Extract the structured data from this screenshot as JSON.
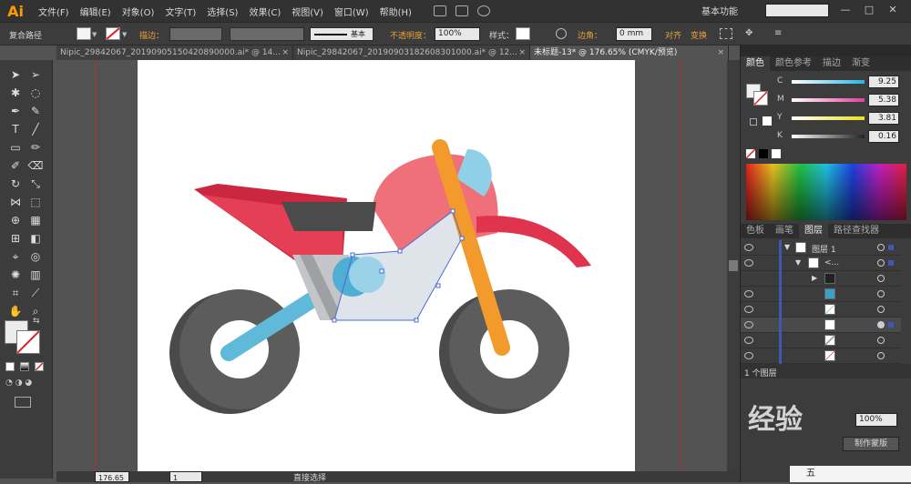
{
  "app": {
    "logo": "Ai"
  },
  "menu": [
    "文件(F)",
    "编辑(E)",
    "对象(O)",
    "文字(T)",
    "选择(S)",
    "效果(C)",
    "视图(V)",
    "窗口(W)",
    "帮助(H)"
  ],
  "workspace": "基本功能",
  "control": {
    "label": "复合路径",
    "stroke_label": "描边：",
    "stroke_style": "基本",
    "opacity_label": "不透明度：",
    "opacity_value": "100%",
    "style_label": "样式：",
    "corner_label": "边角：",
    "corner_value": "0 mm",
    "align_label": "对齐",
    "transform_label": "变换"
  },
  "tabs": [
    {
      "label": "Nipic_29842067_20190905150420890000.ai* @ 14...",
      "active": false
    },
    {
      "label": "Nipic_29842067_20190903182608301000.ai* @ 12...",
      "active": false
    },
    {
      "label": "未标题-13* @ 176.65% (CMYK/预览)",
      "active": true
    }
  ],
  "color_panel": {
    "tabs": [
      "颜色",
      "颜色参考",
      "描边",
      "渐变"
    ],
    "channels": [
      {
        "label": "C",
        "value": "9.25",
        "color": "#29b6e8"
      },
      {
        "label": "M",
        "value": "5.38",
        "color": "#e0409b"
      },
      {
        "label": "Y",
        "value": "3.81",
        "color": "#e8e020"
      },
      {
        "label": "K",
        "value": "0.16",
        "color": "#222222"
      }
    ]
  },
  "layers_panel": {
    "tabs": [
      "色板",
      "画笔",
      "图层",
      "路径查找器"
    ],
    "layer_name": "图层 1",
    "group_name": "<...",
    "footer": "1 个图层"
  },
  "status": {
    "zoom": "176.65",
    "page": "1",
    "tool": "直接选择"
  },
  "overlay": {
    "watermark": "经验",
    "button": "制作蒙版",
    "opacity_value": "100%",
    "taskbar_text": "五"
  }
}
